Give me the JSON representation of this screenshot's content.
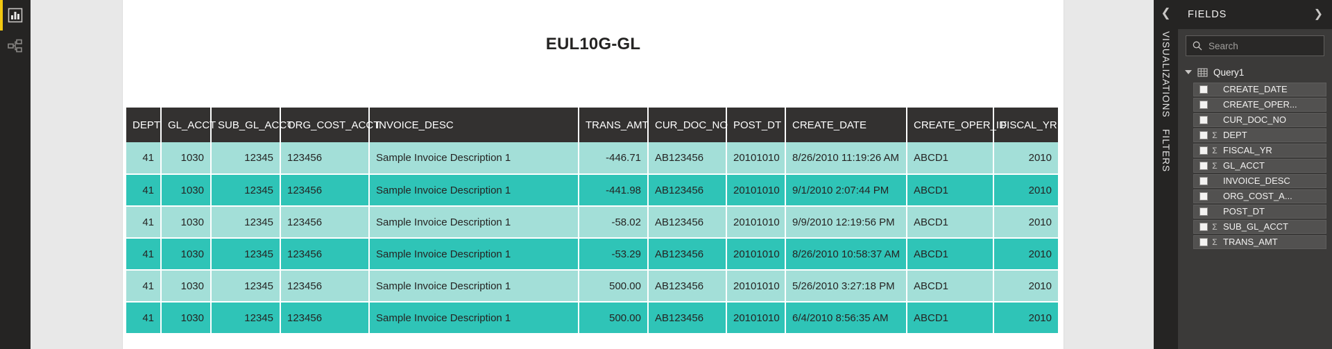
{
  "left_rail": {
    "items": [
      {
        "name": "report-view",
        "icon": "bar-chart-icon",
        "selected": true
      },
      {
        "name": "model-view",
        "icon": "relationships-icon",
        "selected": false
      }
    ],
    "accent_color": "#F2C811",
    "background_color": "#252423"
  },
  "report": {
    "title": "EUL10G-GL",
    "page_background": "#FFFFFF",
    "canvas_background": "#E8E8E8"
  },
  "table": {
    "header_background": "#333130",
    "header_text_color": "#FFFFFF",
    "row_color_odd": "#A3DFD8",
    "row_color_even": "#2FC4B7",
    "columns": [
      {
        "key": "dept",
        "label": "DEPT",
        "align": "right"
      },
      {
        "key": "gl",
        "label": "GL_ACCT",
        "align": "right"
      },
      {
        "key": "subgl",
        "label": "SUB_GL_ACCT",
        "align": "right"
      },
      {
        "key": "org",
        "label": "ORG_COST_ACCT",
        "align": "left"
      },
      {
        "key": "inv",
        "label": "INVOICE_DESC",
        "align": "left"
      },
      {
        "key": "trans",
        "label": "TRANS_AMT",
        "align": "right"
      },
      {
        "key": "curdoc",
        "label": "CUR_DOC_NO",
        "align": "left"
      },
      {
        "key": "post",
        "label": "POST_DT",
        "align": "left"
      },
      {
        "key": "create",
        "label": "CREATE_DATE",
        "align": "left"
      },
      {
        "key": "oper",
        "label": "CREATE_OPER_ID",
        "align": "left"
      },
      {
        "key": "fy",
        "label": "FISCAL_YR",
        "align": "right"
      }
    ],
    "rows": [
      {
        "dept": "41",
        "gl": "1030",
        "subgl": "12345",
        "org": "123456",
        "inv": "Sample Invoice Description 1",
        "trans": "-446.71",
        "curdoc": "AB123456",
        "post": "20101010",
        "create": "8/26/2010 11:19:26 AM",
        "oper": "ABCD1",
        "fy": "2010"
      },
      {
        "dept": "41",
        "gl": "1030",
        "subgl": "12345",
        "org": "123456",
        "inv": "Sample Invoice Description 1",
        "trans": "-441.98",
        "curdoc": "AB123456",
        "post": "20101010",
        "create": "9/1/2010 2:07:44 PM",
        "oper": "ABCD1",
        "fy": "2010"
      },
      {
        "dept": "41",
        "gl": "1030",
        "subgl": "12345",
        "org": "123456",
        "inv": "Sample Invoice Description 1",
        "trans": "-58.02",
        "curdoc": "AB123456",
        "post": "20101010",
        "create": "9/9/2010 12:19:56 PM",
        "oper": "ABCD1",
        "fy": "2010"
      },
      {
        "dept": "41",
        "gl": "1030",
        "subgl": "12345",
        "org": "123456",
        "inv": "Sample Invoice Description 1",
        "trans": "-53.29",
        "curdoc": "AB123456",
        "post": "20101010",
        "create": "8/26/2010 10:58:37 AM",
        "oper": "ABCD1",
        "fy": "2010"
      },
      {
        "dept": "41",
        "gl": "1030",
        "subgl": "12345",
        "org": "123456",
        "inv": "Sample Invoice Description 1",
        "trans": "500.00",
        "curdoc": "AB123456",
        "post": "20101010",
        "create": "5/26/2010 3:27:18 PM",
        "oper": "ABCD1",
        "fy": "2010"
      },
      {
        "dept": "41",
        "gl": "1030",
        "subgl": "12345",
        "org": "123456",
        "inv": "Sample Invoice Description 1",
        "trans": "500.00",
        "curdoc": "AB123456",
        "post": "20101010",
        "create": "6/4/2010 8:56:35 AM",
        "oper": "ABCD1",
        "fy": "2010"
      }
    ]
  },
  "right_tabs": {
    "collapse_icon": "chevron-left-icon",
    "items": [
      {
        "label": "VISUALIZATIONS"
      },
      {
        "label": "FILTERS"
      }
    ]
  },
  "fields_pane": {
    "title": "FIELDS",
    "expand_icon": "chevron-right-icon",
    "search": {
      "placeholder": "Search",
      "value": "",
      "icon": "search-icon"
    },
    "table_node": {
      "label": "Query1",
      "icon": "table-grid-icon",
      "expanded": true
    },
    "fields": [
      {
        "label": "CREATE_DATE",
        "checked": false,
        "aggregate": false
      },
      {
        "label": "CREATE_OPER...",
        "checked": false,
        "aggregate": false
      },
      {
        "label": "CUR_DOC_NO",
        "checked": false,
        "aggregate": false
      },
      {
        "label": "DEPT",
        "checked": false,
        "aggregate": true
      },
      {
        "label": "FISCAL_YR",
        "checked": false,
        "aggregate": true
      },
      {
        "label": "GL_ACCT",
        "checked": false,
        "aggregate": true
      },
      {
        "label": "INVOICE_DESC",
        "checked": false,
        "aggregate": false
      },
      {
        "label": "ORG_COST_A...",
        "checked": false,
        "aggregate": false
      },
      {
        "label": "POST_DT",
        "checked": false,
        "aggregate": false
      },
      {
        "label": "SUB_GL_ACCT",
        "checked": false,
        "aggregate": true
      },
      {
        "label": "TRANS_AMT",
        "checked": false,
        "aggregate": true
      }
    ]
  }
}
